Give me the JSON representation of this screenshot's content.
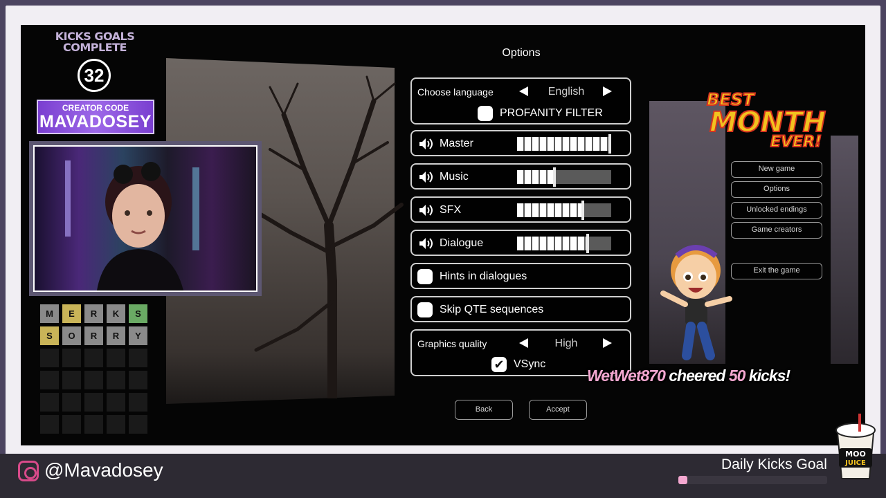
{
  "goal_widget": {
    "title_line1": "KICKS GOALS",
    "title_line2": "COMPLETE",
    "count": "32"
  },
  "creator_code": {
    "label": "CREATOR CODE",
    "code": "MAVADOSEY"
  },
  "wordle": {
    "rows": [
      [
        {
          "l": "M",
          "s": "gray"
        },
        {
          "l": "E",
          "s": "yellow"
        },
        {
          "l": "R",
          "s": "gray"
        },
        {
          "l": "K",
          "s": "gray"
        },
        {
          "l": "S",
          "s": "green"
        }
      ],
      [
        {
          "l": "S",
          "s": "yellow"
        },
        {
          "l": "O",
          "s": "gray"
        },
        {
          "l": "R",
          "s": "gray"
        },
        {
          "l": "R",
          "s": "gray"
        },
        {
          "l": "Y",
          "s": "gray"
        }
      ]
    ]
  },
  "options": {
    "title": "Options",
    "language": {
      "label": "Choose language",
      "value": "English"
    },
    "profanity_filter": {
      "label": "PROFANITY FILTER",
      "checked": false
    },
    "volume": [
      {
        "label": "Master",
        "level": 1.0
      },
      {
        "label": "Music",
        "level": 0.4
      },
      {
        "label": "SFX",
        "level": 0.7
      },
      {
        "label": "Dialogue",
        "level": 0.75
      }
    ],
    "hints": {
      "label": "Hints in dialogues",
      "checked": false
    },
    "skip_qte": {
      "label": "Skip QTE sequences",
      "checked": false
    },
    "graphics": {
      "label": "Graphics quality",
      "value": "High"
    },
    "vsync": {
      "label": "VSync",
      "checked": true
    },
    "back_label": "Back",
    "accept_label": "Accept"
  },
  "side_menu": [
    {
      "label": "New game"
    },
    {
      "label": "Options"
    },
    {
      "label": "Unlocked endings"
    },
    {
      "label": "Game creators"
    },
    {
      "label": "Exit the game"
    }
  ],
  "best_month": {
    "line1": "BEST",
    "line2": "MONTH",
    "line3": "EVER!"
  },
  "cheer": {
    "user": "WetWet870",
    "middle": " cheered ",
    "amount": "50",
    "unit": " kicks!"
  },
  "bottom": {
    "handle": "@Mavadosey",
    "daily_goal_label": "Daily Kicks Goal",
    "daily_goal_progress": 0.06,
    "moo_line1": "MOO",
    "moo_line2": "JUICE"
  },
  "colors": {
    "accent_purple": "#7a3fd0",
    "cheer_pink": "#f4a7d0",
    "best_month_yellow": "#f3c21f",
    "best_month_red": "#d6331f"
  }
}
